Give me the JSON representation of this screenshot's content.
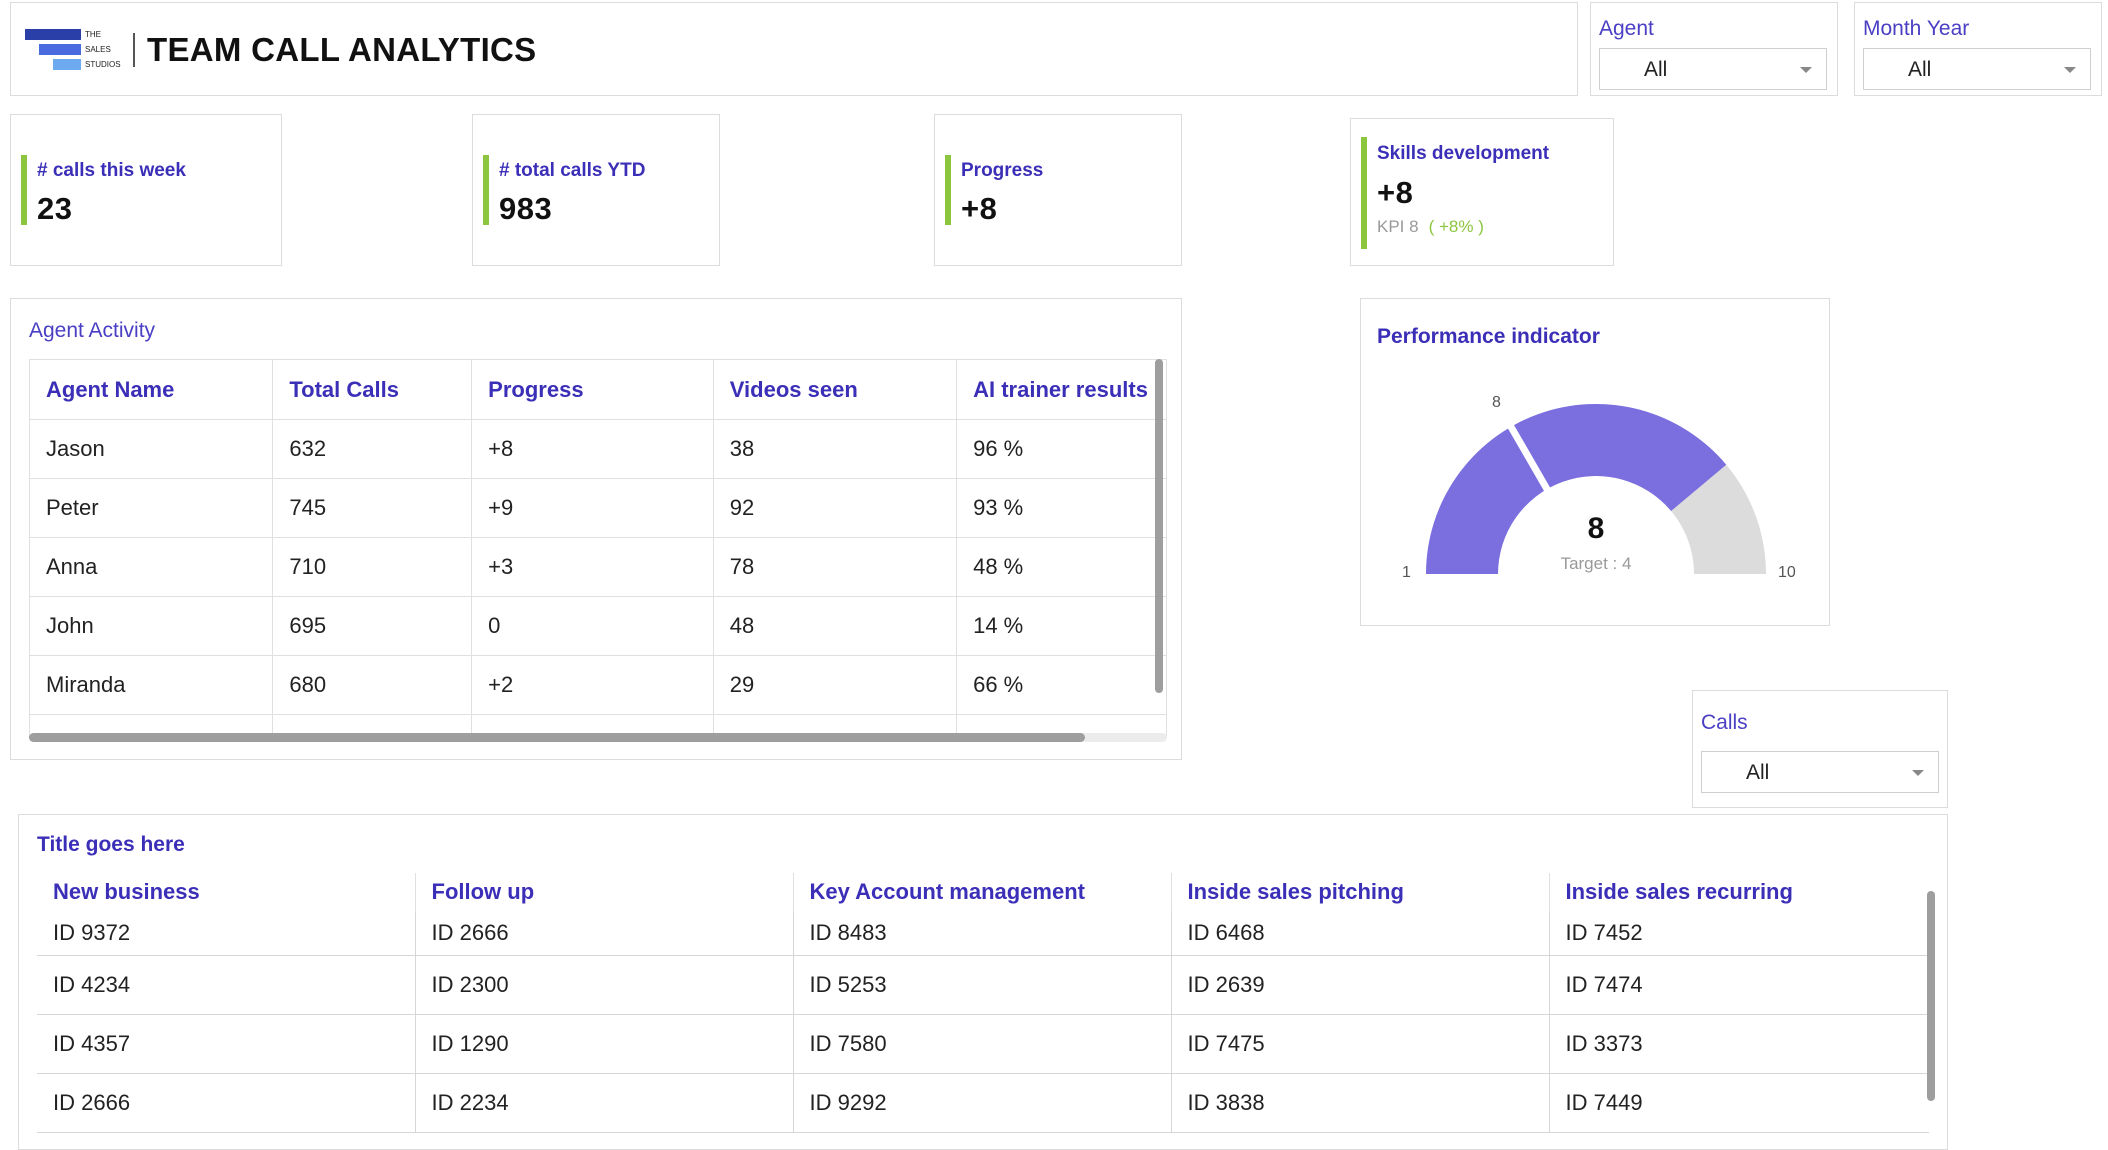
{
  "header": {
    "logo_lines": [
      "THE",
      "SALES",
      "STUDIOS"
    ],
    "title": "TEAM CALL ANALYTICS"
  },
  "filters": {
    "agent": {
      "label": "Agent",
      "value": "All"
    },
    "month_year": {
      "label": "Month Year",
      "value": "All"
    },
    "calls": {
      "label": "Calls",
      "value": "All"
    }
  },
  "kpis": {
    "calls_week": {
      "label": "# calls this week",
      "value": "23"
    },
    "total_ytd": {
      "label": "# total calls YTD",
      "value": "983"
    },
    "progress": {
      "label": "Progress",
      "value": "+8"
    },
    "skills": {
      "label": "Skills development",
      "value": "+8",
      "sub": "KPI 8",
      "delta": "( +8% )"
    }
  },
  "agent_activity": {
    "title": "Agent Activity",
    "columns": [
      "Agent Name",
      "Total Calls",
      "Progress",
      "Videos seen",
      "AI trainer results"
    ],
    "rows": [
      [
        "Jason",
        "632",
        "+8",
        "38",
        "96 %"
      ],
      [
        "Peter",
        "745",
        "+9",
        "92",
        "93 %"
      ],
      [
        "Anna",
        "710",
        "+3",
        "78",
        "48 %"
      ],
      [
        "John",
        "695",
        "0",
        "48",
        "14 %"
      ],
      [
        "Miranda",
        "680",
        "+2",
        "29",
        "66 %"
      ]
    ]
  },
  "performance": {
    "title": "Performance indicator",
    "value": "8",
    "target_label": "Target : 4",
    "min": "1",
    "max": "10",
    "marker_label": "8",
    "gauge": {
      "min": 1,
      "max": 10,
      "value": 8,
      "marker": 4
    },
    "colors": {
      "fill": "#7b6fe0",
      "track": "#dcdcdc",
      "marker": "#ffffff"
    }
  },
  "bottom_table": {
    "title": "Title goes here",
    "columns": [
      "New business",
      "Follow up",
      "Key Account management",
      "Inside sales pitching",
      "Inside sales recurring"
    ],
    "rows": [
      [
        "ID 9372",
        "ID 2666",
        "ID 8483",
        "ID 6468",
        "ID 7452"
      ],
      [
        "ID 4234",
        "ID 2300",
        "ID 5253",
        "ID 2639",
        "ID 7474"
      ],
      [
        "ID 4357",
        "ID 1290",
        "ID 7580",
        "ID 7475",
        "ID 3373"
      ],
      [
        "ID 2666",
        "ID 2234",
        "ID 9292",
        "ID 3838",
        "ID 7449"
      ]
    ]
  },
  "colors": {
    "accent_green": "#8cc63f",
    "label_purple": "#3b2fb8"
  }
}
